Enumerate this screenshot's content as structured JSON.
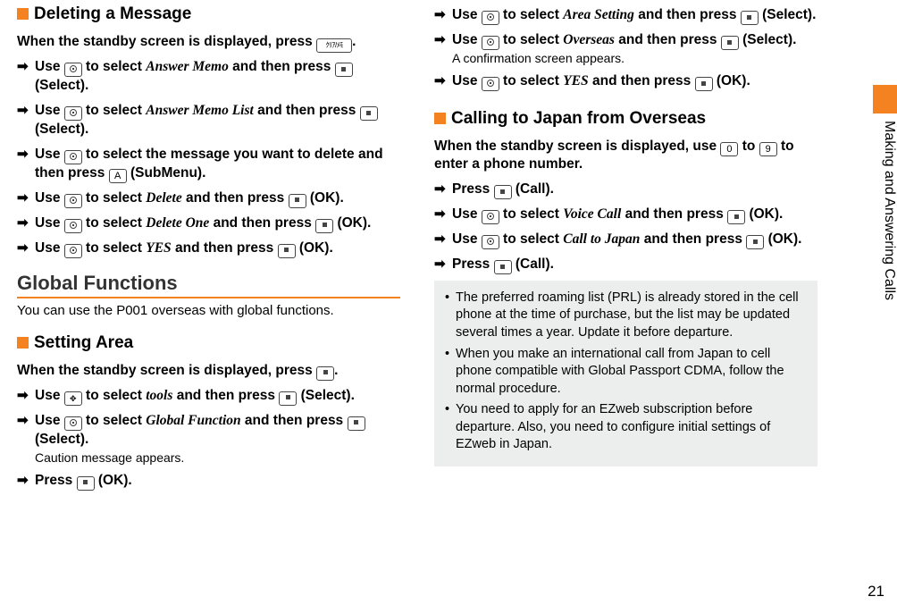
{
  "left": {
    "heading1": "Deleting a Message",
    "intro1_a": "When the standby screen is displayed, press ",
    "intro1_b": ".",
    "steps1": [
      {
        "pre": "Use ",
        "mid": " to select ",
        "it": "Answer Memo",
        "post": " and then press ",
        "act": " (Select)."
      },
      {
        "pre": "Use ",
        "mid": " to select ",
        "it": "Answer Memo List",
        "post": " and then press ",
        "act": " (Select)."
      },
      {
        "pre": "Use ",
        "mid": " to select the message you want to delete and then press ",
        "post2": " (SubMenu)."
      },
      {
        "pre": "Use ",
        "mid": " to select ",
        "it": "Delete",
        "post": " and then press ",
        "act": " (OK)."
      },
      {
        "pre": "Use ",
        "mid": " to select ",
        "it": "Delete One",
        "post": " and then press ",
        "act": " (OK)."
      },
      {
        "pre": "Use ",
        "mid": " to select ",
        "it": "YES",
        "post": " and then press ",
        "act": " (OK)."
      }
    ],
    "heading_main": "Global Functions",
    "main_body": "You can use the P001 overseas with global functions.",
    "heading2": "Setting Area",
    "intro2_a": "When the standby screen is displayed, press ",
    "intro2_b": ".",
    "steps2": [
      {
        "pre": "Use ",
        "mid": " to select ",
        "it": "tools",
        "post": " and then press ",
        "act": " (Select)."
      },
      {
        "pre": "Use ",
        "mid": " to select ",
        "it": "Global Function",
        "post": " and then press ",
        "act": " (Select).",
        "note": "Caution message appears."
      },
      {
        "pre": "Press ",
        "act": " (OK)."
      }
    ]
  },
  "right": {
    "steps_top": [
      {
        "pre": "Use ",
        "mid": " to select ",
        "it": "Area Setting",
        "post": " and then press ",
        "act": " (Select)."
      },
      {
        "pre": "Use ",
        "mid": " to select ",
        "it": "Overseas",
        "post": " and then press ",
        "act": " (Select).",
        "note": "A confirmation screen appears."
      },
      {
        "pre": "Use ",
        "mid": " to select ",
        "it": "YES",
        "post": " and then press ",
        "act": " (OK)."
      }
    ],
    "heading": "Calling to Japan from Overseas",
    "intro_a": "When the standby screen is displayed, use ",
    "intro_mid": " to ",
    "intro_b": " to enter a phone number.",
    "key0": "0",
    "key9": "9",
    "steps_body": [
      {
        "pre": "Press ",
        "act": " (Call)."
      },
      {
        "pre": "Use ",
        "mid": " to select ",
        "it": "Voice Call",
        "post": " and then press ",
        "act": " (OK)."
      },
      {
        "pre": "Use ",
        "mid": " to select ",
        "it": "Call to Japan",
        "post": " and then press ",
        "act": " (OK)."
      },
      {
        "pre": "Press ",
        "act": " (Call)."
      }
    ],
    "info": [
      "The preferred roaming list (PRL) is already stored in the cell phone at the time of purchase, but the list may be updated several times a year. Update it before departure.",
      "When you make an international call from Japan to cell phone compatible with Global Passport CDMA, follow the normal procedure.",
      "You need to apply for an EZweb subscription before departure. Also, you need to configure initial settings of EZweb in Japan."
    ]
  },
  "side_label": "Making and Answering Calls",
  "page_num": "21",
  "clear_memo": "ｸﾘｱ/ﾒﾓ"
}
